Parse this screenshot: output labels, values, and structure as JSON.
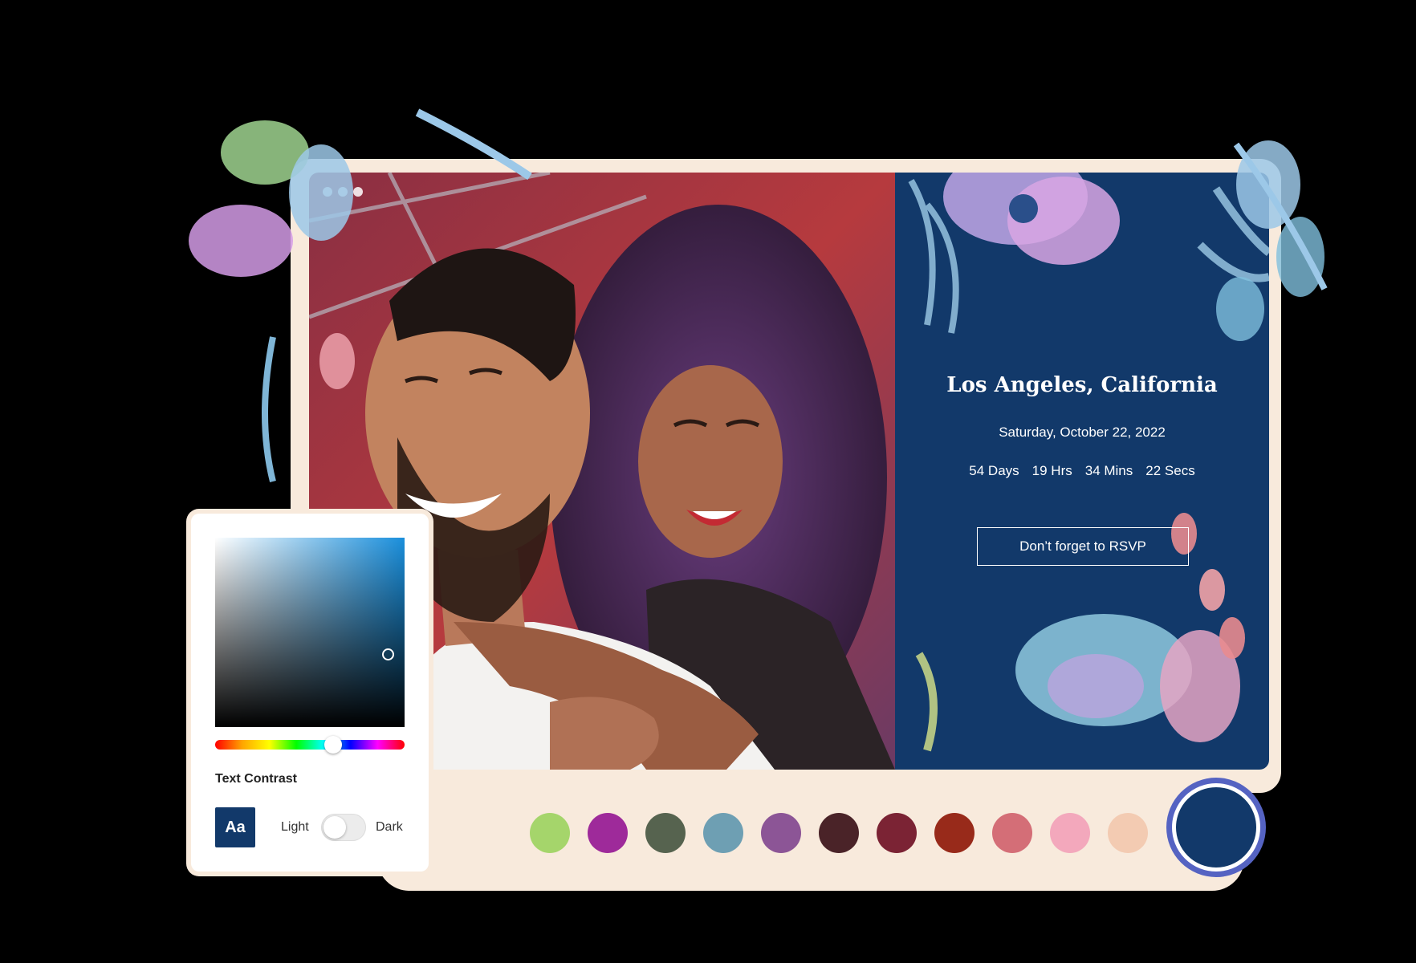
{
  "invitation": {
    "location": "Los Angeles, California",
    "date": "Saturday, October 22, 2022",
    "countdown": [
      "54 Days",
      "19 Hrs",
      "34 Mins",
      "22 Secs"
    ],
    "rsvp_label": "Don’t forget to RSVP",
    "background_color": "#12396a"
  },
  "color_panel": {
    "text_contrast_label": "Text Contrast",
    "preview_text": "Aa",
    "light_label": "Light",
    "dark_label": "Dark",
    "gradient_hue_color": "#1a8fdc"
  },
  "swatches": [
    "#a5d56b",
    "#9e2a9a",
    "#56634f",
    "#6e9fb3",
    "#8c5596",
    "#4a2328",
    "#7b2334",
    "#982a1a",
    "#d46e77",
    "#f3a8bc",
    "#f3cbb2"
  ],
  "selected_swatch": "#12396a",
  "icons": [
    "window-dots-icon",
    "floral-decoration",
    "photo-couple"
  ]
}
